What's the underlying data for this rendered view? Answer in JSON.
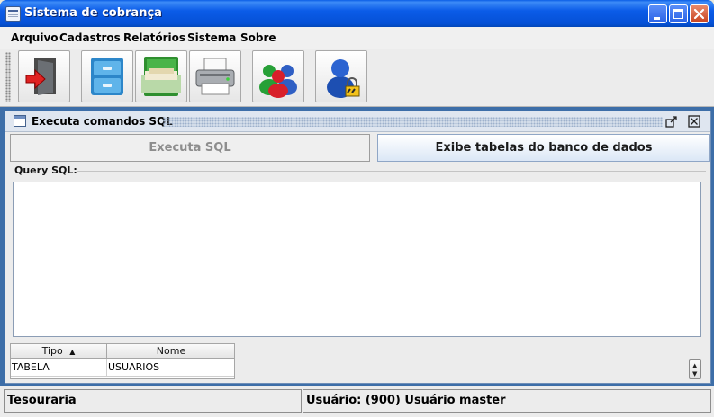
{
  "window": {
    "title": "Sistema de cobrança"
  },
  "menubar": {
    "items": [
      {
        "label": "Arquivo"
      },
      {
        "label": "Cadastros"
      },
      {
        "label": "Relatórios"
      },
      {
        "label": "Sistema"
      },
      {
        "label": "Sobre"
      }
    ]
  },
  "toolbar": {
    "buttons": [
      {
        "icon": "exit-door-icon"
      },
      {
        "icon": "file-cabinet-icon"
      },
      {
        "icon": "open-drawer-icon"
      },
      {
        "icon": "printer-icon"
      },
      {
        "icon": "users-group-icon"
      },
      {
        "icon": "user-lock-icon"
      }
    ]
  },
  "internal_frame": {
    "title": "Executa comandos SQL",
    "execute_button": "Executa SQL",
    "show_tables_button": "Exibe tabelas do banco de dados",
    "query_label": "Query SQL:",
    "table": {
      "columns": [
        "Tipo",
        "Nome"
      ],
      "sort_indicator": "▲",
      "rows": [
        [
          "TABELA",
          "USUARIOS"
        ]
      ]
    }
  },
  "statusbar": {
    "left": "Tesouraria",
    "right": "Usuário: (900) Usuário master"
  },
  "colors": {
    "titlebar": "#0b5ce8",
    "desktop": "#3d6ea8",
    "accent_button": "#dbe7f6"
  }
}
